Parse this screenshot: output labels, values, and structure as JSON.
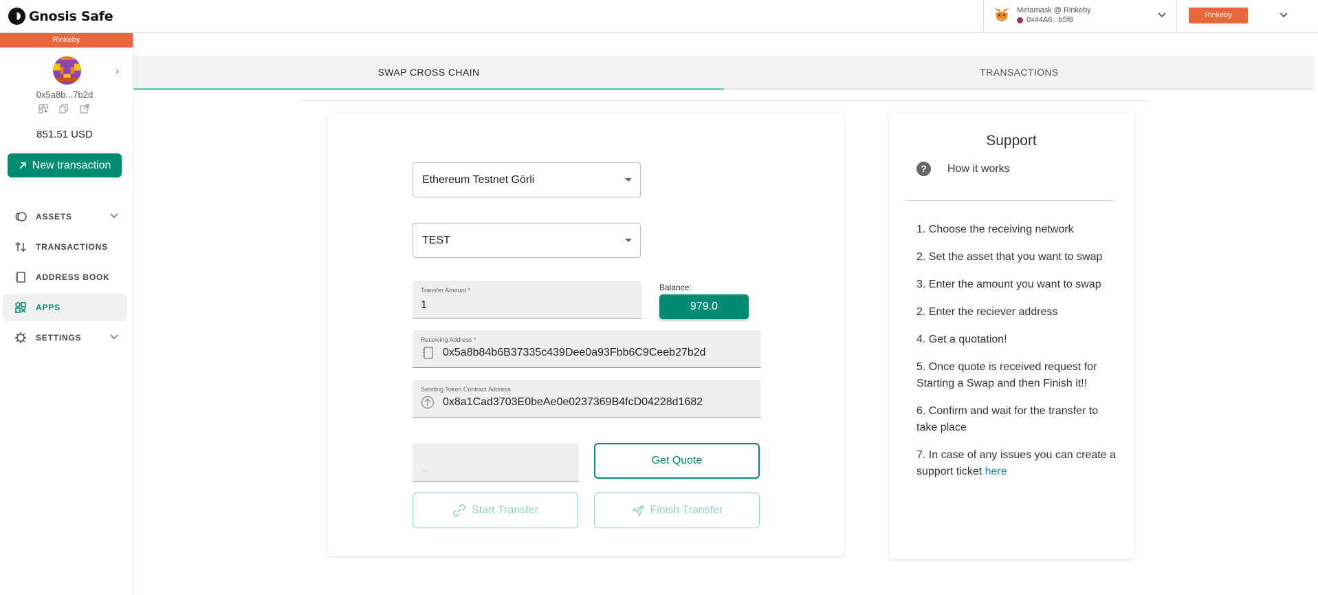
{
  "app": {
    "name": "Gnosis Safe"
  },
  "wallet": {
    "name": "Metamask @ Rinkeby",
    "address": "0x44A6...b5f8",
    "network_badge": "Rinkeby"
  },
  "sidebar": {
    "network": "Rinkeby",
    "safe_address": "0x5a8b...7b2d",
    "balance": "851.51 USD",
    "new_tx_label": "New transaction",
    "items": [
      {
        "label": "ASSETS",
        "icon": "assets-icon"
      },
      {
        "label": "TRANSACTIONS",
        "icon": "transactions-icon"
      },
      {
        "label": "ADDRESS BOOK",
        "icon": "address-book-icon"
      },
      {
        "label": "APPS",
        "icon": "apps-icon",
        "active": true
      },
      {
        "label": "SETTINGS",
        "icon": "settings-icon"
      }
    ]
  },
  "tabs": [
    {
      "label": "SWAP CROSS CHAIN",
      "active": true
    },
    {
      "label": "TRANSACTIONS"
    }
  ],
  "form": {
    "network_select": "Ethereum Testnet Görli",
    "token_select": "TEST",
    "transfer_amount": {
      "label": "Transfer Amount *",
      "value": "1"
    },
    "balance": {
      "label": "Balance:",
      "value": "979.0"
    },
    "receiving_address": {
      "label": "Receiving Address *",
      "value": "0x5a8b84b6B37335c439Dee0a93Fbb6C9Ceeb27b2d"
    },
    "sending_token": {
      "label": "Sending Token Contract Address",
      "value": "0x8a1Cad3703E0beAe0e0237369B4fcD04228d1682"
    },
    "quote_value": "...",
    "get_quote": "Get Quote",
    "start_transfer": "Start Transfer",
    "finish_transfer": "Finish Transfer"
  },
  "support": {
    "title": "Support",
    "how_it_works": "How it works",
    "steps": [
      "1. Choose the receiving network",
      "2. Set the asset that you want to swap",
      "3. Enter the amount you want to swap",
      "2. Enter the reciever address",
      "4. Get a quotation!",
      "5. Once quote is received request for Starting a Swap and then Finish it!!",
      "6. Confirm and wait for the transfer to take place",
      "7. In case of any issues you can create a support ticket"
    ],
    "link_text": "here"
  },
  "colors": {
    "accent": "#008c73",
    "network": "#e8673c",
    "link": "#1a8ad6"
  }
}
